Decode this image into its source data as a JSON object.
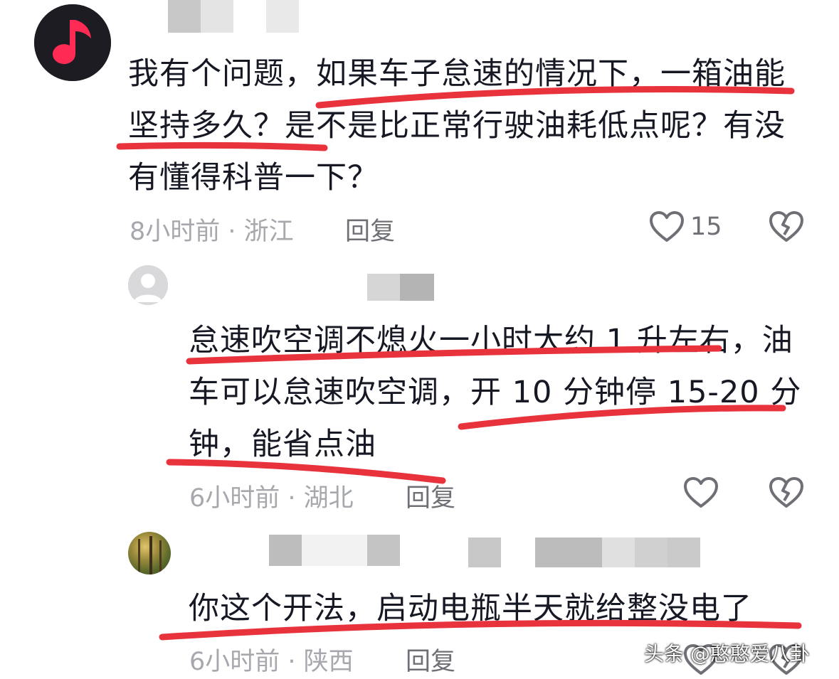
{
  "comments": [
    {
      "text_lines": [
        "我有个问题，如果车子怠速的情况下，一箱油能",
        "坚持多久？是不是比正常行驶油耗低点呢？有没",
        "有懂得科普一下？"
      ],
      "meta": "8小时前 · 浙江",
      "reply_label": "回复",
      "like_count": "15",
      "avatar_icon": "music-note-icon"
    },
    {
      "text_lines": [
        "怠速吹空调不熄火一小时大约 1 升左右，油",
        "车可以怠速吹空调，开 10 分钟停 15-20 分",
        "钟，能省点油"
      ],
      "meta": "6小时前 · 湖北",
      "reply_label": "回复",
      "avatar_icon": "default-avatar-icon"
    },
    {
      "text_lines": [
        "你这个开法，启动电瓶半天就给整没电了"
      ],
      "meta": "6小时前 · 陕西",
      "reply_label": "回复",
      "avatar_icon": "forest-photo-avatar"
    }
  ],
  "watermark": "头条 @憨憨爱八卦",
  "colors": {
    "underline": "#e8323c",
    "text": "#161823",
    "meta": "#a7a8ad",
    "reply": "#6f7076",
    "accent_pink": "#ff2b55"
  }
}
